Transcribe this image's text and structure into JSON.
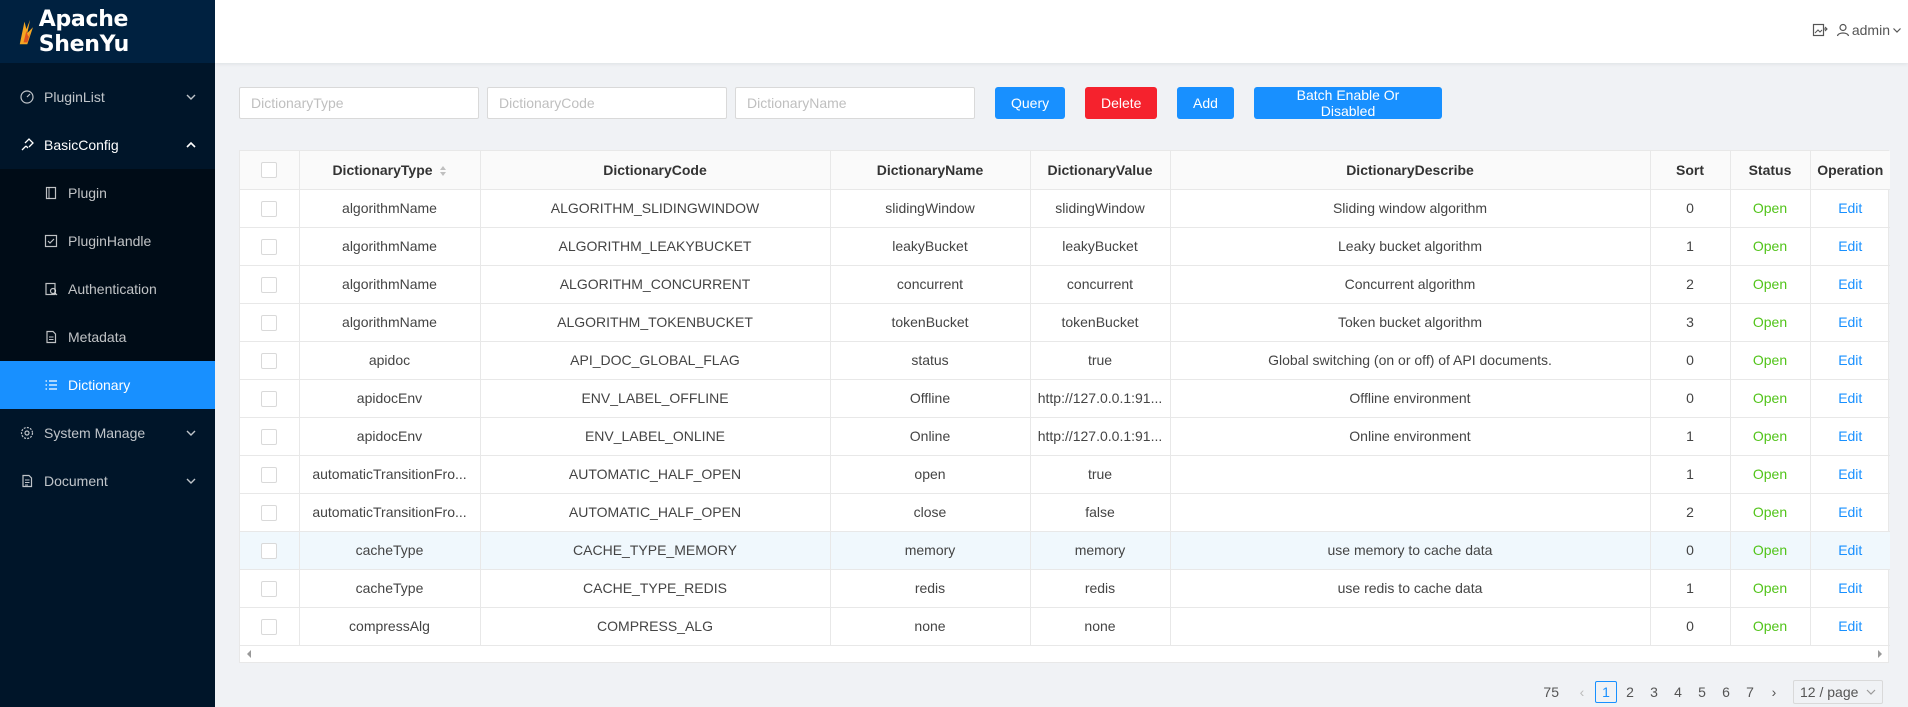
{
  "app": {
    "title": "Apache ShenYu"
  },
  "header": {
    "user": "admin"
  },
  "sidebar": {
    "items": [
      {
        "label": "PluginList"
      },
      {
        "label": "BasicConfig"
      },
      {
        "label": "Plugin"
      },
      {
        "label": "PluginHandle"
      },
      {
        "label": "Authentication"
      },
      {
        "label": "Metadata"
      },
      {
        "label": "Dictionary"
      },
      {
        "label": "System Manage"
      },
      {
        "label": "Document"
      }
    ]
  },
  "filters": {
    "type_placeholder": "DictionaryType",
    "code_placeholder": "DictionaryCode",
    "name_placeholder": "DictionaryName"
  },
  "toolbar": {
    "query": "Query",
    "delete": "Delete",
    "add": "Add",
    "batch": "Batch Enable Or Disabled"
  },
  "table": {
    "columns": [
      "DictionaryType",
      "DictionaryCode",
      "DictionaryName",
      "DictionaryValue",
      "DictionaryDescribe",
      "Sort",
      "Status",
      "Operation"
    ],
    "rows": [
      [
        "algorithmName",
        "ALGORITHM_SLIDINGWINDOW",
        "slidingWindow",
        "slidingWindow",
        "Sliding window algorithm",
        "0",
        "Open",
        "Edit"
      ],
      [
        "algorithmName",
        "ALGORITHM_LEAKYBUCKET",
        "leakyBucket",
        "leakyBucket",
        "Leaky bucket algorithm",
        "1",
        "Open",
        "Edit"
      ],
      [
        "algorithmName",
        "ALGORITHM_CONCURRENT",
        "concurrent",
        "concurrent",
        "Concurrent algorithm",
        "2",
        "Open",
        "Edit"
      ],
      [
        "algorithmName",
        "ALGORITHM_TOKENBUCKET",
        "tokenBucket",
        "tokenBucket",
        "Token bucket algorithm",
        "3",
        "Open",
        "Edit"
      ],
      [
        "apidoc",
        "API_DOC_GLOBAL_FLAG",
        "status",
        "true",
        "Global switching (on or off) of API documents.",
        "0",
        "Open",
        "Edit"
      ],
      [
        "apidocEnv",
        "ENV_LABEL_OFFLINE",
        "Offline",
        "http://127.0.0.1:91...",
        "Offline environment",
        "0",
        "Open",
        "Edit"
      ],
      [
        "apidocEnv",
        "ENV_LABEL_ONLINE",
        "Online",
        "http://127.0.0.1:91...",
        "Online environment",
        "1",
        "Open",
        "Edit"
      ],
      [
        "automaticTransitionFro...",
        "AUTOMATIC_HALF_OPEN",
        "open",
        "true",
        "",
        "1",
        "Open",
        "Edit"
      ],
      [
        "automaticTransitionFro...",
        "AUTOMATIC_HALF_OPEN",
        "close",
        "false",
        "",
        "2",
        "Open",
        "Edit"
      ],
      [
        "cacheType",
        "CACHE_TYPE_MEMORY",
        "memory",
        "memory",
        "use memory to cache data",
        "0",
        "Open",
        "Edit"
      ],
      [
        "cacheType",
        "CACHE_TYPE_REDIS",
        "redis",
        "redis",
        "use redis to cache data",
        "1",
        "Open",
        "Edit"
      ],
      [
        "compressAlg",
        "COMPRESS_ALG",
        "none",
        "none",
        "",
        "0",
        "Open",
        "Edit"
      ]
    ]
  },
  "pagination": {
    "total": "75",
    "pages": [
      "1",
      "2",
      "3",
      "4",
      "5",
      "6",
      "7"
    ],
    "current": "1",
    "page_size": "12 / page"
  },
  "colors": {
    "primary": "#1890ff",
    "danger": "#f5222d",
    "success": "#52c41a",
    "sidebar_bg": "#001529"
  }
}
